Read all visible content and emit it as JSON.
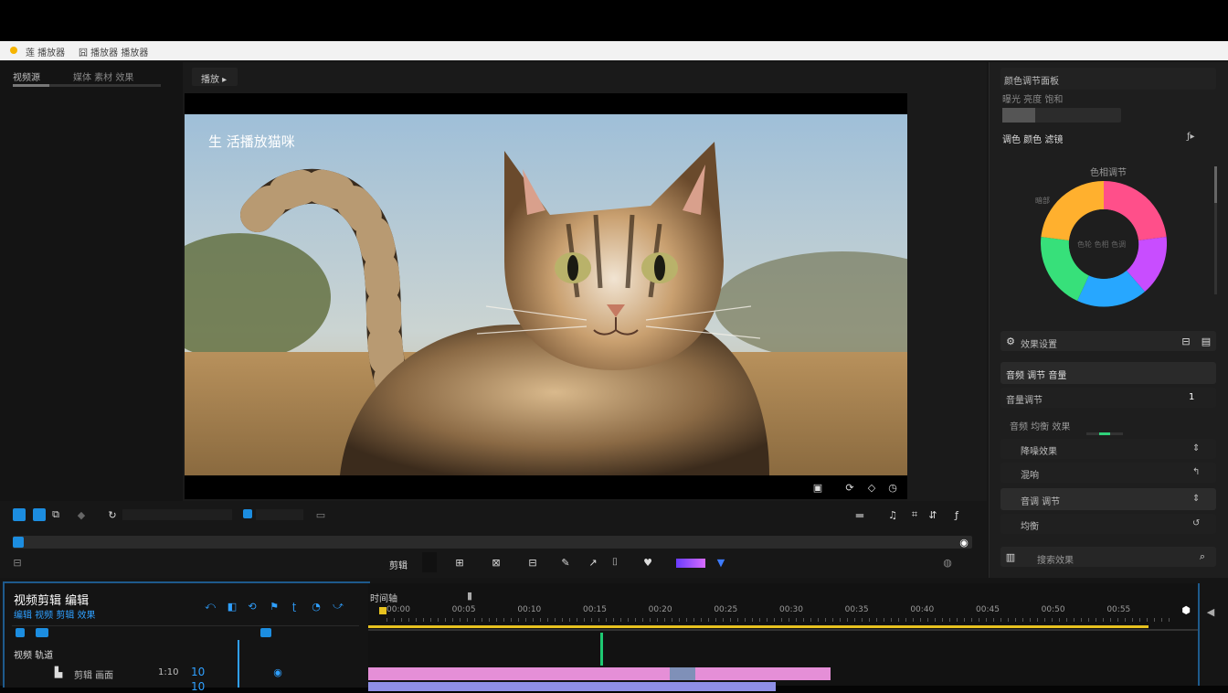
{
  "titlebar": {
    "label1": "莲 播放器",
    "label2": "囧 播放器 播放器"
  },
  "left_panel": {
    "title": "视频源",
    "tabs": "媒体 素材 效果"
  },
  "viewer": {
    "tab_label": "播放 ▸",
    "overlay_text": "生 活播放猫咪",
    "corner_icons": [
      "frame-icon",
      "refresh-icon",
      "diamond-icon",
      "clock-icon"
    ]
  },
  "right_panel": {
    "header": "颜色调节面板",
    "subheader": "曝光 亮度 饱和",
    "section_label": "调色 颜色 滤镜",
    "section_right": "ƒ▸",
    "wheel_top": "色相调节",
    "wheel_center": "色轮 色相 色调",
    "wheel_left": "暗部",
    "effects_label": "效果设置",
    "section2": "音频 调节 音量",
    "row_label": "音量调节",
    "row_value": "1",
    "group_label": "音频 均衡 效果",
    "rows": [
      {
        "label": "降噪效果",
        "icon": "⇕"
      },
      {
        "label": "混响",
        "icon": "↰"
      },
      {
        "label": "音调 调节",
        "icon": "⇕"
      },
      {
        "label": "均衡",
        "icon": "↺"
      }
    ],
    "search_placeholder": "搜索效果"
  },
  "controls": {
    "center_label": "剪辑",
    "tool_icons": [
      "trim-icon",
      "split-icon",
      "crop-icon",
      "pen-icon",
      "marker-icon",
      "heart-icon",
      "gradient-icon",
      "filter-icon"
    ]
  },
  "timeline": {
    "title": "视频剪辑 编辑",
    "subtitle": "编辑 视频 剪辑 效果",
    "track_header": "视频 轨道",
    "track1_label": "剪辑 画面",
    "track1_time": "1:10",
    "track1_value": "10",
    "track2_value": "10",
    "ruler_label": "时间轴",
    "ruler_ticks": [
      "00:00",
      "00:05",
      "00:10",
      "00:15",
      "00:20",
      "00:25",
      "00:30",
      "00:35",
      "00:40",
      "00:45",
      "00:50",
      "00:55"
    ],
    "colors": {
      "playhead": "#e7c21f",
      "cursor": "#1ec972",
      "clip1": "#e58fd7",
      "clip2": "#8f8fe6"
    }
  }
}
